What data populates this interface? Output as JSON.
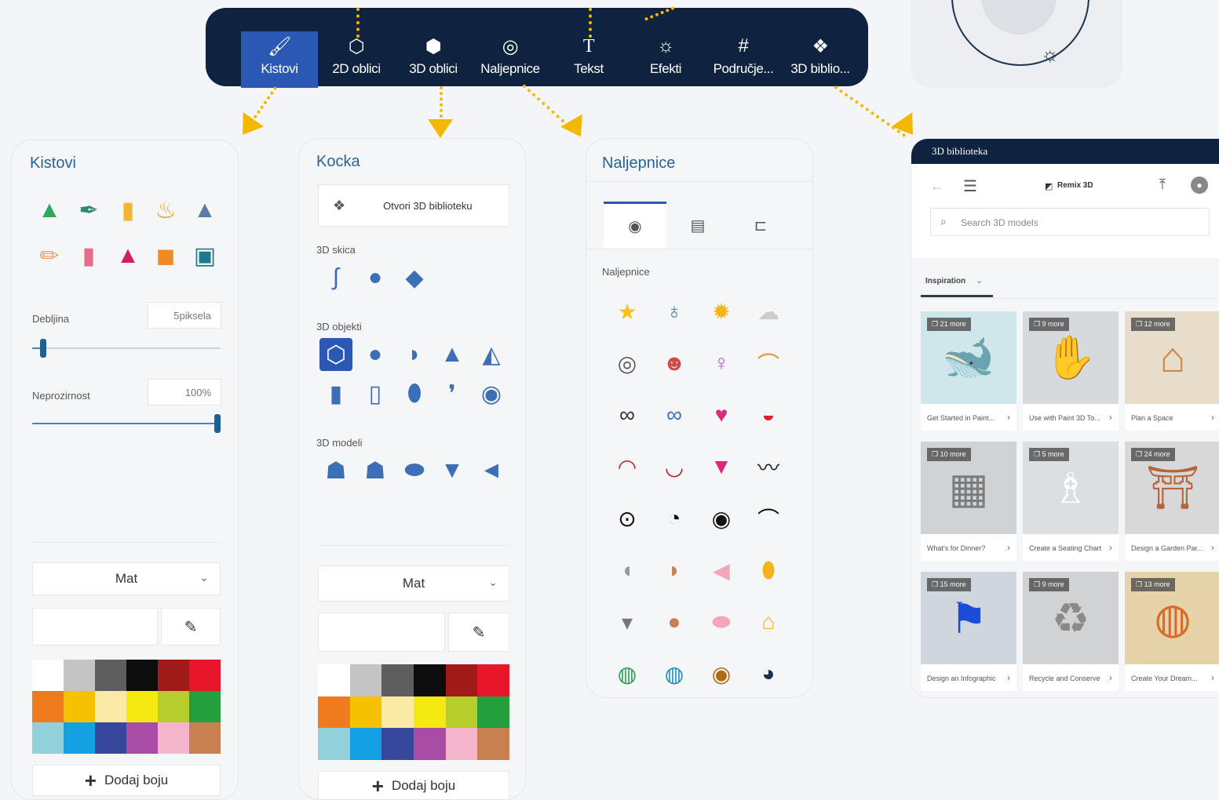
{
  "toolbar": {
    "items": [
      {
        "label": "Kistovi",
        "icon": "brush-icon",
        "active": true
      },
      {
        "label": "2D oblici",
        "icon": "2d-shapes-icon",
        "active": false
      },
      {
        "label": "3D oblici",
        "icon": "3d-cube-icon",
        "active": false
      },
      {
        "label": "Naljepnice",
        "icon": "sticker-icon",
        "active": false
      },
      {
        "label": "Tekst",
        "icon": "text-t-icon",
        "active": false
      },
      {
        "label": "Efekti",
        "icon": "sun-effects-icon",
        "active": false
      },
      {
        "label": "Područje...",
        "icon": "crop-canvas-icon",
        "active": false
      },
      {
        "label": "3D biblio...",
        "icon": "3d-library-icon",
        "active": false
      }
    ],
    "accent": "#2b57b5",
    "background": "#0f2340"
  },
  "brushes": {
    "title": "Kistovi",
    "thickness_label": "Debljina",
    "thickness_value": "5piksela",
    "thickness_fraction": 0.06,
    "opacity_label": "Neprozirnost",
    "opacity_value": "100%",
    "opacity_fraction": 1.0,
    "material": "Mat",
    "add_color": "Dodaj boju"
  },
  "shapes3d": {
    "title": "Kocka",
    "open_library": "Otvori 3D biblioteku",
    "sketch_label": "3D skica",
    "objects_label": "3D objekti",
    "models_label": "3D modeli",
    "material": "Mat",
    "add_color": "Dodaj boju"
  },
  "stickers": {
    "title": "Naljepnice",
    "section_label": "Naljepnice"
  },
  "library": {
    "window_title": "3D biblioteka",
    "brand": "Remix 3D",
    "search_placeholder": "Search 3D models",
    "tab_label": "Inspiration",
    "tiles": [
      {
        "badge": "21 more",
        "caption": "Get Started in Paint...",
        "icon": "whale-icon"
      },
      {
        "badge": "9 more",
        "caption": "Use with Paint 3D To...",
        "icon": "hand-icon"
      },
      {
        "badge": "12 more",
        "caption": "Plan a Space",
        "icon": "room-icon"
      },
      {
        "badge": "10 more",
        "caption": "What's for Dinner?",
        "icon": "stove-icon"
      },
      {
        "badge": "5 more",
        "caption": "Create a Seating Chart",
        "icon": "chair-icon"
      },
      {
        "badge": "24 more",
        "caption": "Design a Garden Par...",
        "icon": "arbor-icon"
      },
      {
        "badge": "15 more",
        "caption": "Design an Infographic",
        "icon": "flag-icon"
      },
      {
        "badge": "9 more",
        "caption": "Recycle and Conserve",
        "icon": "recycle-icon"
      },
      {
        "badge": "13 more",
        "caption": "Create Your Dream...",
        "icon": "island-icon"
      }
    ]
  },
  "palette": [
    "#ffffff",
    "#c4c4c4",
    "#5e5e5e",
    "#0d0d0d",
    "#a01a1a",
    "#e8162a",
    "#f07a1e",
    "#f6c100",
    "#fbe9a6",
    "#f4ea12",
    "#b6cd2c",
    "#23a03d",
    "#92d1db",
    "#13a1e4",
    "#36479c",
    "#a94ca5",
    "#f5b5cd",
    "#c98050"
  ]
}
